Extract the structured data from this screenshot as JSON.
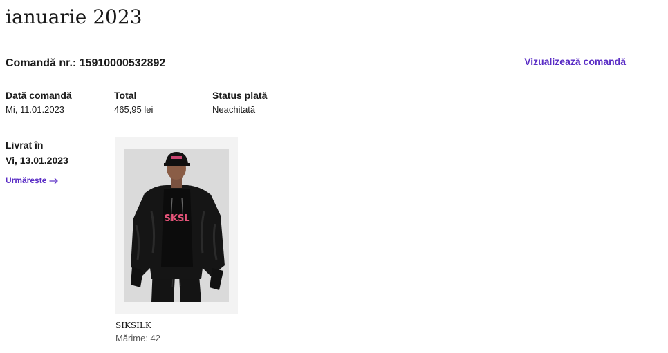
{
  "month_title": "ianuarie 2023",
  "order": {
    "number_label": "Comandă nr.: 15910000532892",
    "view_link": "Vizualizează comandă",
    "order_date": {
      "label": "Dată comandă",
      "value": "Mi, 11.01.2023"
    },
    "total": {
      "label": "Total",
      "value": "465,95 lei"
    },
    "payment_status": {
      "label": "Status plată",
      "value": "Neachitată"
    }
  },
  "delivery": {
    "label": "Livrat în",
    "date": "Vi, 13.01.2023",
    "track_link": "Urmărește",
    "track_icon": "arrow-right-icon"
  },
  "product": {
    "brand": "SIKSILK",
    "size": "Mărime: 42",
    "image_subject": "model wearing black hooded bomber jacket and cap",
    "print_text": "SKSL"
  },
  "colors": {
    "accent": "#5a2dc5",
    "text": "#1a1a1a",
    "muted": "#555555",
    "divider": "#d6d6d6",
    "card_bg": "#f3f3f3"
  }
}
